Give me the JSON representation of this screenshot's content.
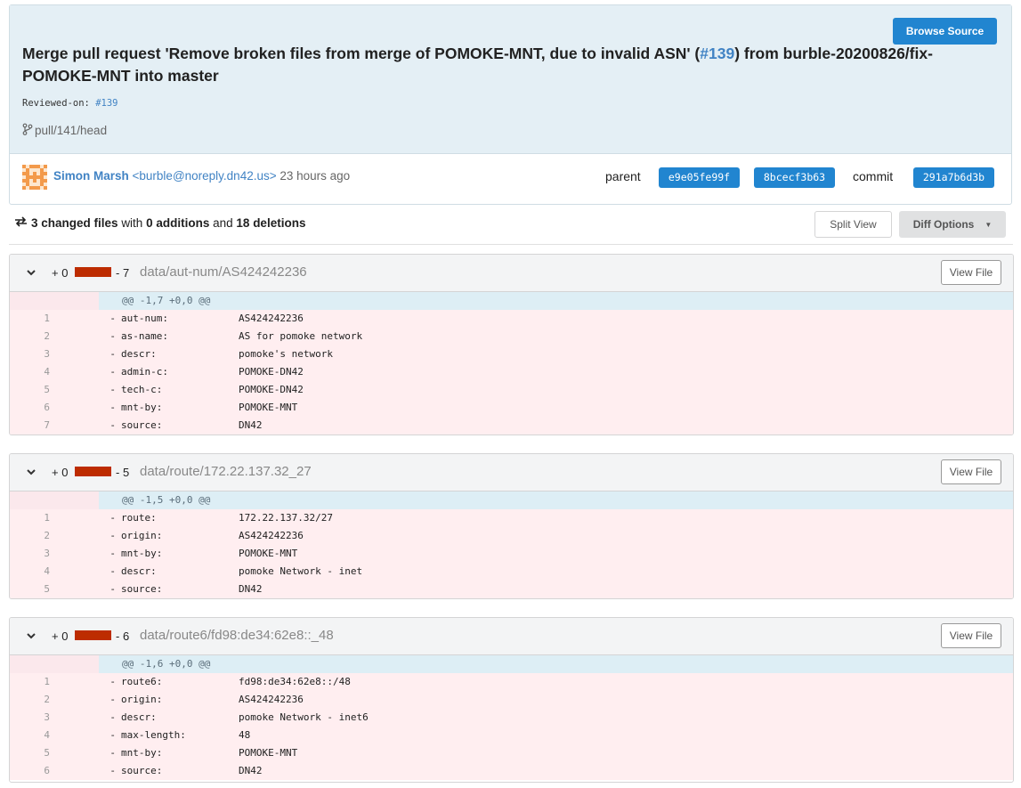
{
  "header": {
    "browse_label": "Browse Source",
    "title_part1": "Merge pull request 'Remove broken files from merge of POMOKE-MNT, due to invalid ASN' (",
    "title_pr_link": "#139",
    "title_part2": ") from burble-20200826/fix-POMOKE-MNT into master",
    "reviewed_label": "Reviewed-on:",
    "reviewed_link": "#139",
    "branch": "pull/141/head"
  },
  "author": {
    "name": "Simon Marsh",
    "email": "<burble@noreply.dn42.us>",
    "time": "23 hours ago",
    "parent_label": "parent",
    "parent_shas": [
      "e9e05fe99f",
      "8bcecf3b63"
    ],
    "commit_label": "commit",
    "commit_sha": "291a7b6d3b"
  },
  "stats": {
    "changed": "3 changed files",
    "with": "with",
    "additions": "0 additions",
    "and": "and",
    "deletions": "18 deletions",
    "split_view": "Split View",
    "diff_options": "Diff Options"
  },
  "files": [
    {
      "add": "+ 0",
      "del": "- 7",
      "path": "data/aut-num/AS424242236",
      "view": "View File",
      "hunk": "@@ -1,7 +0,0 @@",
      "lines": [
        {
          "n": "1",
          "k": "aut-num:",
          "v": "AS424242236"
        },
        {
          "n": "2",
          "k": "as-name:",
          "v": "AS for pomoke network"
        },
        {
          "n": "3",
          "k": "descr:",
          "v": "pomoke's network"
        },
        {
          "n": "4",
          "k": "admin-c:",
          "v": "POMOKE-DN42"
        },
        {
          "n": "5",
          "k": "tech-c:",
          "v": "POMOKE-DN42"
        },
        {
          "n": "6",
          "k": "mnt-by:",
          "v": "POMOKE-MNT"
        },
        {
          "n": "7",
          "k": "source:",
          "v": "DN42"
        }
      ]
    },
    {
      "add": "+ 0",
      "del": "- 5",
      "path": "data/route/172.22.137.32_27",
      "view": "View File",
      "hunk": "@@ -1,5 +0,0 @@",
      "lines": [
        {
          "n": "1",
          "k": "route:",
          "v": "172.22.137.32/27"
        },
        {
          "n": "2",
          "k": "origin:",
          "v": "AS424242236"
        },
        {
          "n": "3",
          "k": "mnt-by:",
          "v": "POMOKE-MNT"
        },
        {
          "n": "4",
          "k": "descr:",
          "v": "pomoke Network - inet"
        },
        {
          "n": "5",
          "k": "source:",
          "v": "DN42"
        }
      ]
    },
    {
      "add": "+ 0",
      "del": "- 6",
      "path": "data/route6/fd98:de34:62e8::_48",
      "view": "View File",
      "hunk": "@@ -1,6 +0,0 @@",
      "lines": [
        {
          "n": "1",
          "k": "route6:",
          "v": "fd98:de34:62e8::/48"
        },
        {
          "n": "2",
          "k": "origin:",
          "v": "AS424242236"
        },
        {
          "n": "3",
          "k": "descr:",
          "v": "pomoke Network - inet6"
        },
        {
          "n": "4",
          "k": "max-length:",
          "v": "48"
        },
        {
          "n": "5",
          "k": "mnt-by:",
          "v": "POMOKE-MNT"
        },
        {
          "n": "6",
          "k": "source:",
          "v": "DN42"
        }
      ]
    }
  ],
  "colors": {
    "accent": "#2185d0",
    "link": "#4183c4",
    "deleted_bg": "#ffeef0",
    "deletion_bar": "#bd2c00"
  }
}
